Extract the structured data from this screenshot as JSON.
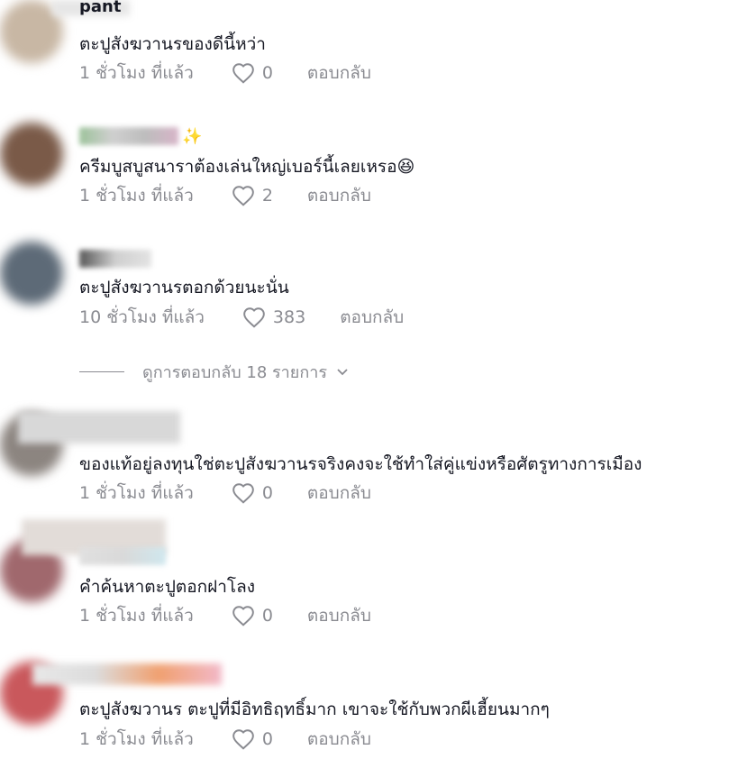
{
  "comments": [
    {
      "username": "pant",
      "text": "ตะปูสังฆวานรของดีนี้หว่า",
      "time": "1 ชั่วโมง ที่แล้ว",
      "likes": "0",
      "reply": "ตอบกลับ",
      "avatar_color": "#c8b7a4"
    },
    {
      "username": "",
      "username_emoji": "✨",
      "text": "ครีมบูสบูสนาราต้องเล่นใหญ่เบอร์นี้เลยเหรอ",
      "text_emoji": "😆",
      "time": "1 ชั่วโมง ที่แล้ว",
      "likes": "2",
      "reply": "ตอบกลับ",
      "avatar_color": "#7a5a48"
    },
    {
      "username": "",
      "text": "ตะปูสังฆวานรตอกด้วยนะนั่น",
      "time": "10 ชั่วโมง ที่แล้ว",
      "likes": "383",
      "reply": "ตอบกลับ",
      "avatar_color": "#5d6a77"
    },
    {
      "username": "",
      "text": "ของแท้อยู่ลงทุนใช่ตะปูสังฆวานรจริงคงจะใช้ทำใส่คู่แข่งหรือศัตรูทางการเมือง",
      "time": "1 ชั่วโมง ที่แล้ว",
      "likes": "0",
      "reply": "ตอบกลับ",
      "avatar_color": "#8c8580"
    },
    {
      "username": "",
      "text": "คำค้นหาตะปูตอกฝาโลง",
      "time": "1 ชั่วโมง ที่แล้ว",
      "likes": "0",
      "reply": "ตอบกลับ",
      "avatar_color": "#a0686d"
    },
    {
      "username": "",
      "text": "ตะปูสังฆวานร ตะปูที่มีอิทธิฤทธิ์มาก เขาจะใช้กับพวกผีเฮี้ยนมากๆ",
      "time": "1 ชั่วโมง ที่แล้ว",
      "likes": "0",
      "reply": "ตอบกลับ",
      "avatar_color": "#c9585c"
    }
  ],
  "view_replies": {
    "label": "ดูการตอบกลับ 18 รายการ"
  },
  "icons": {
    "heart": "heart-outline-icon",
    "chevron": "chevron-down-icon"
  }
}
